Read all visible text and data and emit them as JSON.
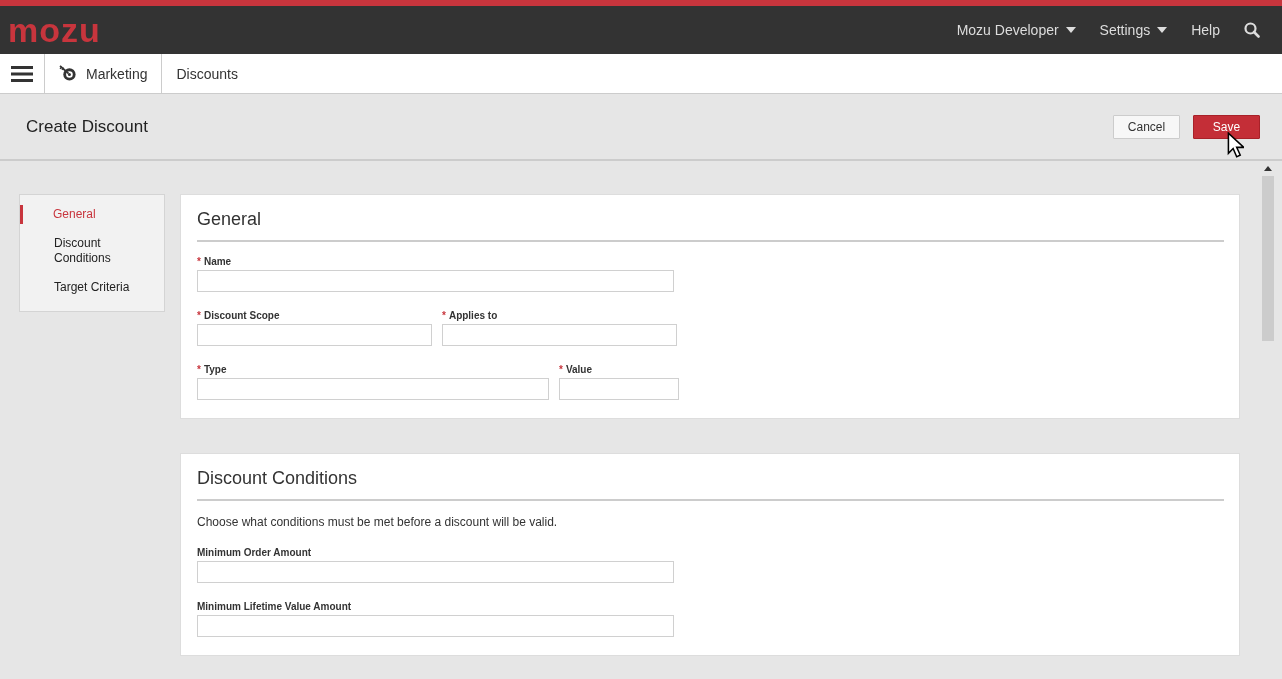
{
  "topbar": {
    "logo": "mozu",
    "menus": [
      {
        "label": "Mozu Developer",
        "dropdown": true
      },
      {
        "label": "Settings",
        "dropdown": true
      },
      {
        "label": "Help",
        "dropdown": false
      }
    ]
  },
  "breadcrumb": [
    {
      "label": "Marketing"
    },
    {
      "label": "Discounts"
    }
  ],
  "header": {
    "title": "Create Discount",
    "buttons": [
      {
        "label": "Cancel",
        "kind": "secondary"
      },
      {
        "label": "Save",
        "kind": "primary"
      }
    ]
  },
  "sidebar": {
    "items": [
      {
        "label": "General",
        "selected": true
      },
      {
        "label": "Discount Conditions",
        "selected": false
      },
      {
        "label": "Target Criteria",
        "selected": false
      }
    ]
  },
  "sections": [
    {
      "title": "General",
      "rows": [
        [
          {
            "label": "Name",
            "mark": "*"
          }
        ],
        [
          {
            "label": "Discount Scope",
            "mark": "*"
          },
          {
            "label": "Applies to",
            "mark": "*"
          }
        ],
        [
          {
            "label": "Type",
            "mark": "*"
          },
          {
            "label": "Value",
            "mark": "*"
          }
        ]
      ]
    },
    {
      "title": "Discount Conditions",
      "description": "Choose what conditions must be met before a discount will be valid.",
      "rows": [
        [
          {
            "label": "Minimum Order Amount"
          }
        ],
        [
          {
            "label": "Minimum Lifetime Value Amount"
          }
        ]
      ]
    }
  ]
}
